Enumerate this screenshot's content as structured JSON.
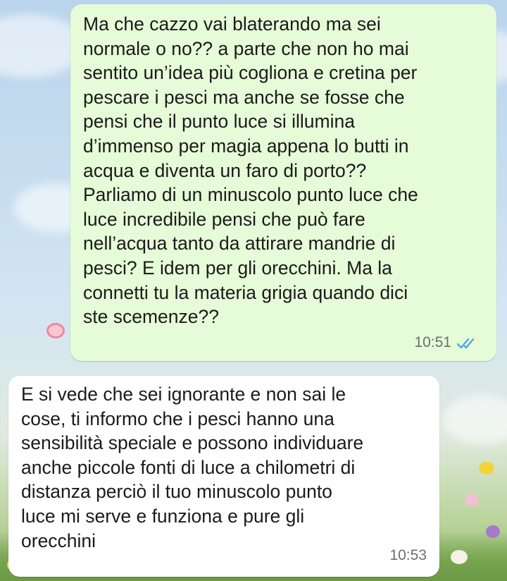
{
  "conversation": {
    "messages": [
      {
        "direction": "outgoing",
        "text": "Ma che cazzo vai blaterando ma sei\nnormale o no?? a parte che non ho mai\nsentito un’idea più cogliona e cretina per\npescare i pesci ma anche se fosse che\npensi che il punto luce si illumina\nd’immenso per magia appena lo butti in\nacqua e diventa un faro di porto??\nParliamo di un minuscolo punto luce che\nluce incredibile pensi che può fare\nnell’acqua tanto da attirare mandrie di\npesci? E idem per gli orecchini. Ma la\nconnetti tu la materia grigia quando dici\nste scemenze??",
        "time": "10:51",
        "status_icon": "double-check-read-icon",
        "status_color": "#4fa5e8"
      },
      {
        "direction": "incoming",
        "text": "E si vede che sei ignorante e non sai le\ncose, ti informo che i pesci hanno una\nsensibilità speciale e possono individuare\nanche piccole fonti di luce a chilometri di\ndistanza perciò il tuo minuscolo punto\nluce mi serve  e funziona e pure gli\norecchini",
        "time": "10:53"
      }
    ]
  },
  "theme": {
    "outgoing_bubble": "#e6fbd8",
    "incoming_bubble": "#ffffff",
    "text_color": "#1b1b1b",
    "time_color": "#6b6f6b"
  }
}
